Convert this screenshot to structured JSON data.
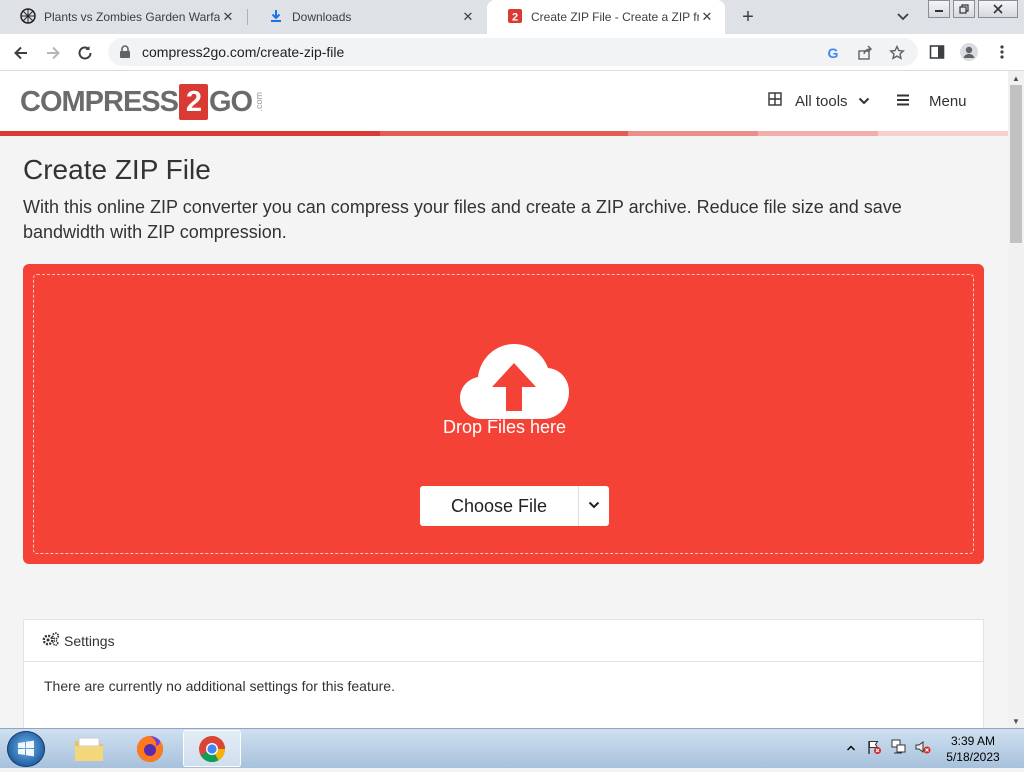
{
  "browser": {
    "tabs": [
      {
        "title": "Plants vs Zombies Garden Warfare",
        "icon": "game-favicon",
        "active": false
      },
      {
        "title": "Downloads",
        "icon": "download-icon",
        "active": false
      },
      {
        "title": "Create ZIP File - Create a ZIP from",
        "icon": "compress2go-favicon",
        "active": true
      }
    ],
    "new_tab_label": "+",
    "url": "compress2go.com/create-zip-file"
  },
  "site": {
    "logo_prefix": "COMPRESS",
    "logo_two": "2",
    "logo_suffix": "GO",
    "logo_tld": ".com",
    "all_tools_label": "All tools",
    "menu_label": "Menu",
    "accent": "#f44336"
  },
  "main": {
    "title": "Create ZIP File",
    "description": "With this online ZIP converter you can compress your files and create a ZIP archive. Reduce file size and save bandwidth with ZIP compression.",
    "drop_text": "Drop Files here",
    "choose_file_label": "Choose File"
  },
  "settings": {
    "heading": "Settings",
    "message": "There are currently no additional settings for this feature."
  },
  "taskbar": {
    "apps": [
      "file-explorer-icon",
      "firefox-icon",
      "chrome-icon"
    ],
    "time": "3:39 AM",
    "date": "5/18/2023"
  }
}
